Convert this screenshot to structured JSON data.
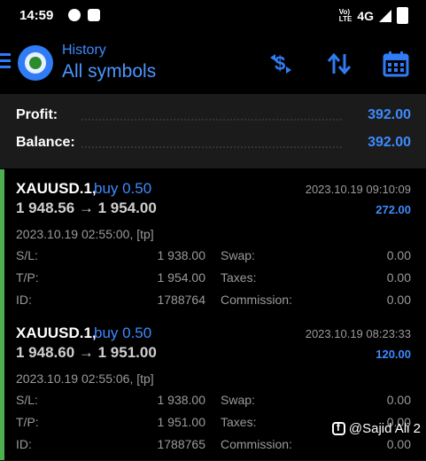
{
  "status_bar": {
    "time": "14:59",
    "network": "4G",
    "volte_label": "Vo)\nLTE",
    "icons": [
      "messenger-icon",
      "facebook-icon",
      "volte-icon",
      "signal-icon",
      "battery-icon"
    ]
  },
  "header": {
    "title": "History",
    "subtitle": "All symbols",
    "actions": [
      "currency-filter-icon",
      "sort-icon",
      "calendar-icon"
    ],
    "accent": "#2f7cf6"
  },
  "summary": {
    "profit_label": "Profit:",
    "profit_value": "392.00",
    "balance_label": "Balance:",
    "balance_value": "392.00"
  },
  "labels": {
    "sl": "S/L:",
    "tp": "T/P:",
    "id": "ID:",
    "swap": "Swap:",
    "taxes": "Taxes:",
    "commission": "Commission:"
  },
  "deals": [
    {
      "symbol": "XAUUSD.1,",
      "type": "buy 0.50",
      "prices": "1 948.56 → 1 954.00",
      "close_time": "2023.10.19 09:10:09",
      "profit": "272.00",
      "open_info": "2023.10.19 02:55:00, [tp]",
      "sl": "1 938.00",
      "tp": "1 954.00",
      "id": "1788764",
      "swap": "0.00",
      "taxes": "0.00",
      "commission": "0.00"
    },
    {
      "symbol": "XAUUSD.1,",
      "type": "buy 0.50",
      "prices": "1 948.60 → 1 951.00",
      "close_time": "2023.10.19 08:23:33",
      "profit": "120.00",
      "open_info": "2023.10.19 02:55:06, [tp]",
      "sl": "1 938.00",
      "tp": "1 951.00",
      "id": "1788765",
      "swap": "0.00",
      "taxes": "0.00",
      "commission": "0.00"
    }
  ],
  "watermark": "@Sajid Ali 2"
}
